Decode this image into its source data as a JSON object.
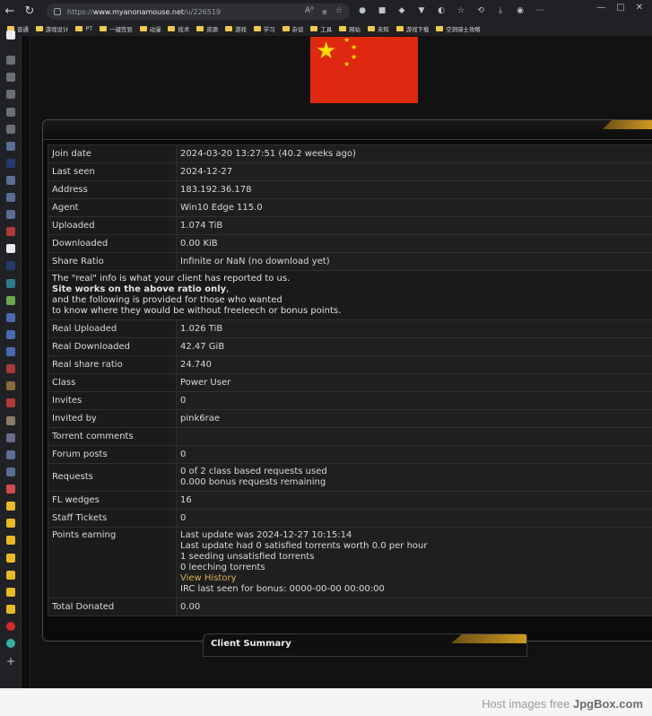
{
  "browser": {
    "url_prefix": "https://",
    "url_host": "www.myanonamouse.net",
    "url_path": "/u/226519",
    "address_icons": [
      "A⁰",
      "ㅎ",
      "☆"
    ],
    "bookmarks": [
      "普通",
      "游戏设计",
      "PT",
      "一键签到",
      "动漫",
      "技术",
      "资源",
      "游戏",
      "学习",
      "杂谈",
      "工具",
      "网站",
      "未知",
      "游戏下载",
      "空洞骑士攻略"
    ]
  },
  "profile": {
    "rows": [
      {
        "label": "Join date",
        "value": "2024-03-20 13:27:51 (40.2 weeks ago)"
      },
      {
        "label": "Last seen",
        "value": "2024-12-27"
      },
      {
        "label": "Address",
        "value": "183.192.36.178"
      },
      {
        "label": "Agent",
        "value": "Win10 Edge 115.0"
      },
      {
        "label": "Uploaded",
        "value": "1.074 TiB"
      },
      {
        "label": "Downloaded",
        "value": "0.00 KiB"
      },
      {
        "label": "Share Ratio",
        "value": "Infinite or NaN (no download yet)"
      }
    ],
    "note": {
      "line1": "The \"real\" info is what your client has reported to us.",
      "line2": "Site works on the above ratio only",
      "line2_suffix": ",",
      "line3": "and the following is provided for those who wanted",
      "line4": "to know where they would be without freeleech or bonus points."
    },
    "rows2": [
      {
        "label": "Real Uploaded",
        "value": "1.026 TiB"
      },
      {
        "label": "Real Downloaded",
        "value": "42.47 GiB"
      },
      {
        "label": "Real share ratio",
        "value": "24.740"
      },
      {
        "label": "Class",
        "value": "Power User"
      },
      {
        "label": "Invites",
        "value": "0"
      },
      {
        "label": "Invited by",
        "value": "pink6rae"
      },
      {
        "label": "Torrent comments",
        "value": ""
      },
      {
        "label": "Forum posts",
        "value": "0"
      }
    ],
    "requests": {
      "label": "Requests",
      "line1": "0 of 2 class based requests used",
      "line2": "0.000 bonus requests remaining"
    },
    "fl_wedges": {
      "label": "FL wedges",
      "value": "16"
    },
    "staff_tickets": {
      "label": "Staff Tickets",
      "value": "0"
    },
    "points": {
      "label": "Points earning",
      "line1": "Last update was 2024-12-27 10:15:14",
      "line2": "Last update had 0 satisfied torrents worth 0.0 per hour",
      "line3": "1 seeding unsatisfied torrents",
      "line4": "0 leeching torrents",
      "link": "View History",
      "line5": "IRC last seen for bonus: 0000-00-00 00:00:00"
    },
    "total_donated": {
      "label": "Total Donated",
      "value": "0.00"
    }
  },
  "client_summary": {
    "title": "Client Summary"
  },
  "footer": {
    "prefix": "Host images free ",
    "brand": "JpgBox.com"
  },
  "colors": {
    "accent": "#d9b354",
    "background": "#121212",
    "flag_red": "#de2910",
    "flag_yellow": "#ffde00"
  }
}
